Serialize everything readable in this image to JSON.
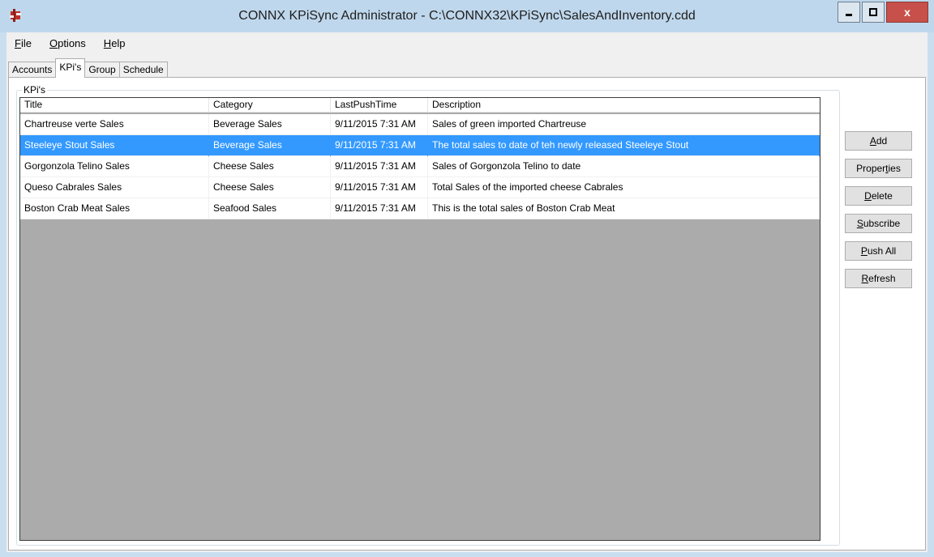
{
  "window": {
    "title": "CONNX KPiSync Administrator - C:\\CONNX32\\KPiSync\\SalesAndInventory.cdd",
    "close_label": "x"
  },
  "menu": {
    "items": [
      {
        "access": "F",
        "rest": "ile"
      },
      {
        "access": "O",
        "rest": "ptions"
      },
      {
        "access": "H",
        "rest": "elp"
      }
    ]
  },
  "tabs": [
    "Accounts",
    "KPi's",
    "Group",
    "Schedule"
  ],
  "active_tab": "KPi's",
  "kpis_group": {
    "label": "KPi's",
    "columns": [
      "Title",
      "Category",
      "LastPushTime",
      "Description"
    ],
    "rows": [
      {
        "title": "Chartreuse verte Sales",
        "category": "Beverage Sales",
        "last_push": "9/11/2015 7:31 AM",
        "description": "Sales of green imported Chartreuse"
      },
      {
        "title": "Steeleye Stout Sales",
        "category": "Beverage Sales",
        "last_push": "9/11/2015 7:31 AM",
        "description": "The total sales to date of teh newly released Steeleye Stout"
      },
      {
        "title": "Gorgonzola Telino Sales",
        "category": "Cheese Sales",
        "last_push": "9/11/2015 7:31 AM",
        "description": "Sales of Gorgonzola Telino to date"
      },
      {
        "title": "Queso Cabrales Sales",
        "category": "Cheese Sales",
        "last_push": "9/11/2015 7:31 AM",
        "description": "Total Sales of the imported cheese Cabrales"
      },
      {
        "title": "Boston Crab Meat Sales",
        "category": "Seafood Sales",
        "last_push": "9/11/2015 7:31 AM",
        "description": "This is the total sales of Boston Crab Meat"
      }
    ],
    "selected_row": 1
  },
  "buttons": {
    "add": {
      "pre": "",
      "access": "A",
      "post": "dd"
    },
    "properties": {
      "pre": "Proper",
      "access": "t",
      "post": "ies"
    },
    "delete": {
      "pre": "",
      "access": "D",
      "post": "elete"
    },
    "subscribe": {
      "pre": "",
      "access": "S",
      "post": "ubscribe"
    },
    "push_all": {
      "pre": "",
      "access": "P",
      "post": "ush All"
    },
    "refresh": {
      "pre": "",
      "access": "R",
      "post": "efresh"
    }
  },
  "colors": {
    "selection": "#3399ff",
    "list_background": "#ababab",
    "close_button": "#c7504a"
  }
}
